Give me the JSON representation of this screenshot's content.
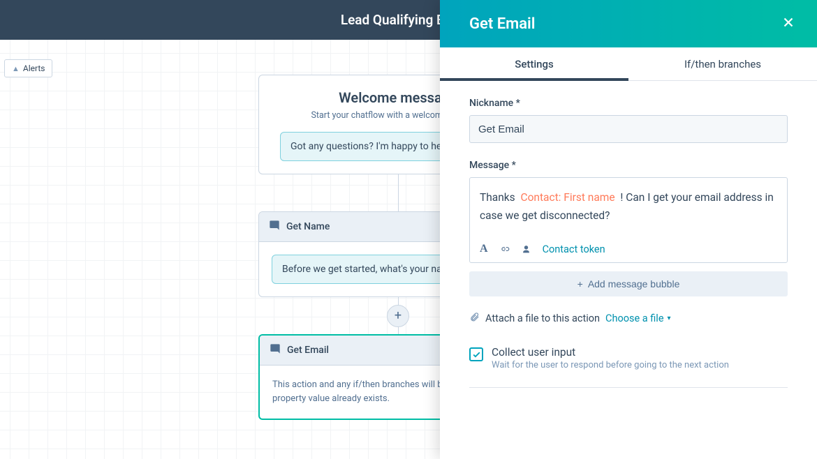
{
  "header": {
    "title": "Lead Qualifying Bot"
  },
  "alerts": {
    "label": "Alerts"
  },
  "flow": {
    "welcome": {
      "title": "Welcome message",
      "subtitle": "Start your chatflow with a welcome message",
      "bubble": "Got any questions? I'm happy to help."
    },
    "getName": {
      "title": "Get Name",
      "bubble": "Before we get started, what's your name?"
    },
    "getEmail": {
      "title": "Get Email",
      "desc": "This action and any if/then branches will be skipped if the property value already exists."
    }
  },
  "panel": {
    "title": "Get Email",
    "tabs": {
      "settings": "Settings",
      "branches": "If/then branches"
    },
    "nickname": {
      "label": "Nickname *",
      "value": "Get Email"
    },
    "message": {
      "label": "Message *",
      "pre": "Thanks ",
      "token": "Contact: First name",
      "post": " ! Can I get your email address in case we get disconnected?",
      "tokenLink": "Contact token",
      "addBubble": "Add message bubble"
    },
    "attach": {
      "text": "Attach a file to this action",
      "choose": "Choose a file"
    },
    "collect": {
      "title": "Collect user input",
      "sub": "Wait for the user to respond before going to the next action"
    }
  }
}
